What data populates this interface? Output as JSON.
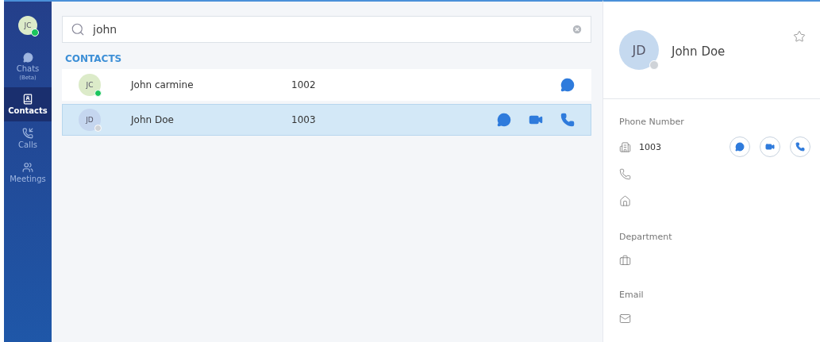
{
  "user": {
    "initials": "JC",
    "online": true
  },
  "nav": [
    {
      "kind": "chats",
      "label": "Chats",
      "sublabel": "(Beta)",
      "selected": false
    },
    {
      "kind": "contacts",
      "label": "Contacts",
      "selected": true
    },
    {
      "kind": "calls",
      "label": "Calls",
      "selected": false
    },
    {
      "kind": "meetings",
      "label": "Meetings",
      "selected": false
    }
  ],
  "search": {
    "value": "john"
  },
  "section_title": "CONTACTS",
  "contacts": [
    {
      "initials": "JC",
      "name": "John carmine",
      "number": "1002",
      "online": true,
      "selected": false,
      "actions": [
        {
          "kind": "chat"
        }
      ]
    },
    {
      "initials": "JD",
      "name": "John Doe",
      "number": "1003",
      "online": false,
      "selected": true,
      "actions": [
        {
          "kind": "chat"
        },
        {
          "kind": "video"
        },
        {
          "kind": "call"
        }
      ]
    }
  ],
  "detail": {
    "initials": "JD",
    "name": "John Doe",
    "online": false,
    "favorite": false,
    "phone_label": "Phone Number",
    "phones": [
      {
        "kind": "work",
        "value": "1003",
        "actions": [
          {
            "kind": "chat"
          },
          {
            "kind": "video"
          },
          {
            "kind": "call"
          }
        ]
      },
      {
        "kind": "mobile"
      },
      {
        "kind": "home"
      }
    ],
    "department_label": "Department",
    "email_label": "Email"
  }
}
